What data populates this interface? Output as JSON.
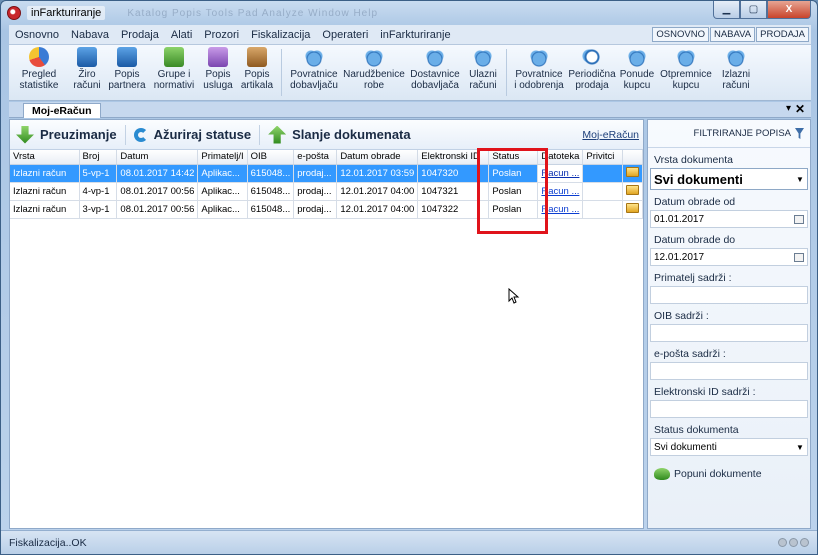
{
  "window": {
    "title": "inFarkturiranje",
    "ghost_title": "Katalog Popis Tools Pad Analyze Window Help",
    "min_icon": "minimize-icon",
    "max_icon": "maximize-icon",
    "close_label": "X"
  },
  "menu": {
    "items": [
      "Osnovno",
      "Nabava",
      "Prodaja",
      "Alati",
      "Prozori",
      "Fiskalizacija",
      "Operateri",
      "inFarkturiranje"
    ],
    "right_tabs": [
      "OSNOVNO",
      "NABAVA",
      "PRODAJA"
    ]
  },
  "ribbon": {
    "buttons": [
      {
        "l1": "Pregled",
        "l2": "statistike",
        "icon": "pie-chart-icon"
      },
      {
        "l1": "Žiro",
        "l2": "računi",
        "icon": "bank-icon"
      },
      {
        "l1": "Popis",
        "l2": "partnera",
        "icon": "partners-icon"
      },
      {
        "l1": "Grupe i",
        "l2": "normativi",
        "icon": "groups-icon"
      },
      {
        "l1": "Popis",
        "l2": "usluga",
        "icon": "services-icon"
      },
      {
        "l1": "Popis",
        "l2": "artikala",
        "icon": "articles-icon"
      },
      {
        "l1": "Povratnice",
        "l2": "dobavljaču",
        "icon": "cloud-icon"
      },
      {
        "l1": "Narudžbenice",
        "l2": "robe",
        "icon": "cloud-icon"
      },
      {
        "l1": "Dostavnice",
        "l2": "dobavljača",
        "icon": "cloud-icon"
      },
      {
        "l1": "Ulazni",
        "l2": "računi",
        "icon": "cloud-icon"
      },
      {
        "l1": "Povratnice",
        "l2": "i odobrenja",
        "icon": "cloud-icon"
      },
      {
        "l1": "Periodična",
        "l2": "prodaja",
        "icon": "clock-icon"
      },
      {
        "l1": "Ponude",
        "l2": "kupcu",
        "icon": "cloud-icon"
      },
      {
        "l1": "Otpremnice",
        "l2": "kupcu",
        "icon": "cloud-icon"
      },
      {
        "l1": "Izlazni",
        "l2": "računi",
        "icon": "cloud-icon"
      }
    ]
  },
  "doc_tab": {
    "label": "Moj-eRačun",
    "pin": "▾",
    "close": "✕"
  },
  "toolbar": {
    "download_label": "Preuzimanje",
    "refresh_label": "Ažuriraj statuse",
    "upload_label": "Slanje dokumenata",
    "link_label": "Moj-eRačun"
  },
  "table": {
    "columns": [
      "Vrsta",
      "Broj",
      "Datum",
      "Primatelj/I",
      "OIB",
      "e-pošta",
      "Datum obrade",
      "Elektronski ID",
      "Status",
      "Datoteka",
      "Privitci",
      ""
    ],
    "rows": [
      {
        "vrsta": "Izlazni račun",
        "broj": "5-vp-1",
        "datum": "08.01.2017 14:42",
        "primatelj": "Aplikac...",
        "oib": "615048...",
        "email": "prodaj...",
        "obrada": "12.01.2017 03:59",
        "eid": "1047320",
        "status": "Poslan",
        "datoteka": "Racun ...",
        "privitci": ""
      },
      {
        "vrsta": "Izlazni račun",
        "broj": "4-vp-1",
        "datum": "08.01.2017 00:56",
        "primatelj": "Aplikac...",
        "oib": "615048...",
        "email": "prodaj...",
        "obrada": "12.01.2017 04:00",
        "eid": "1047321",
        "status": "Poslan",
        "datoteka": "Racun ...",
        "privitci": ""
      },
      {
        "vrsta": "Izlazni račun",
        "broj": "3-vp-1",
        "datum": "08.01.2017 00:56",
        "primatelj": "Aplikac...",
        "oib": "615048...",
        "email": "prodaj...",
        "obrada": "12.01.2017 04:00",
        "eid": "1047322",
        "status": "Poslan",
        "datoteka": "Racun ...",
        "privitci": ""
      }
    ]
  },
  "filter": {
    "title": "FILTRIRANJE POPISA",
    "vrsta_label": "Vrsta dokumenta",
    "vrsta_value": "Svi dokumenti",
    "od_label": "Datum obrade od",
    "od_value": "01.01.2017",
    "do_label": "Datum obrade do",
    "do_value": "12.01.2017",
    "primatelj_label": "Primatelj sadrži :",
    "primatelj_value": "",
    "oib_label": "OIB sadrži :",
    "oib_value": "",
    "email_label": "e-pošta sadrži :",
    "email_value": "",
    "eid_label": "Elektronski ID sadrži :",
    "eid_value": "",
    "status_label": "Status dokumenta",
    "status_value": "Svi dokumenti",
    "fill_button": "Popuni dokumente"
  },
  "status_bar": {
    "text": "Fiskalizacija..OK"
  },
  "colors": {
    "selection": "#3399ff",
    "highlight_box": "#e0131b"
  }
}
